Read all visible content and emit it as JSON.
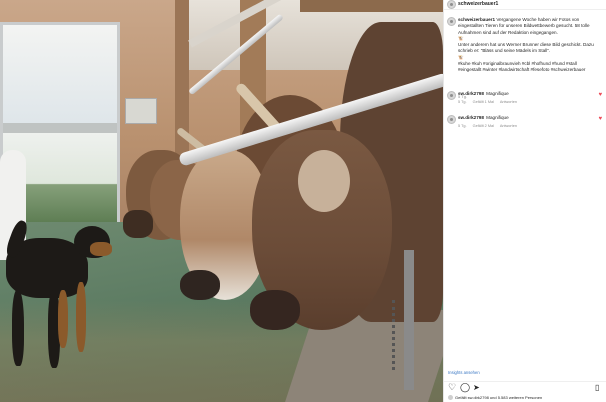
{
  "header": {
    "username": "schweizerbauer1"
  },
  "caption": {
    "username": "schweizerbauer1",
    "line1": "Vergangene Woche haben wir Fotos von",
    "line2": "eingestallten Tieren für unseren Bildwettbewerb gesucht. 58 tolle",
    "line3": "Aufnahmen sind auf der Redaktion eingegangen.",
    "line4": "🐮",
    "line5": "Unter anderem hat uns Werner Brunner diese Bild geschickt. Dazu",
    "line6": "schrieb er: \"Bläss und seine Mädels im Stall\".",
    "line7": "🐮",
    "line8": "#kuhe #kuh #originalbraunvieh #cbl #hofhund #hund #stall",
    "line9": "#eingestallt #winter #landwirtschaft #fesefoto #schweizerbauer",
    "time": "5 Tg."
  },
  "comments": [
    {
      "username": "sw.dirk2798",
      "text": "Magnifique",
      "age": "5 Tg.",
      "likes": "Gefällt 1 Mal",
      "reply": "Antworten"
    },
    {
      "username": "sw.dirk2798",
      "text": "Magnifique",
      "age": "5 Tg.",
      "likes": "Gefällt 2 Mal",
      "reply": "Antworten"
    }
  ],
  "insights_label": "Insights ansehen",
  "likes_text": "Gefällt sw.dirk2798 und 5.583 weiteren Personen",
  "icons": {
    "like": "heart-icon",
    "comment": "comment-icon",
    "share": "share-icon",
    "save": "bookmark-icon"
  },
  "colors": {
    "link": "#3b78c4",
    "heart": "#ed4956"
  }
}
